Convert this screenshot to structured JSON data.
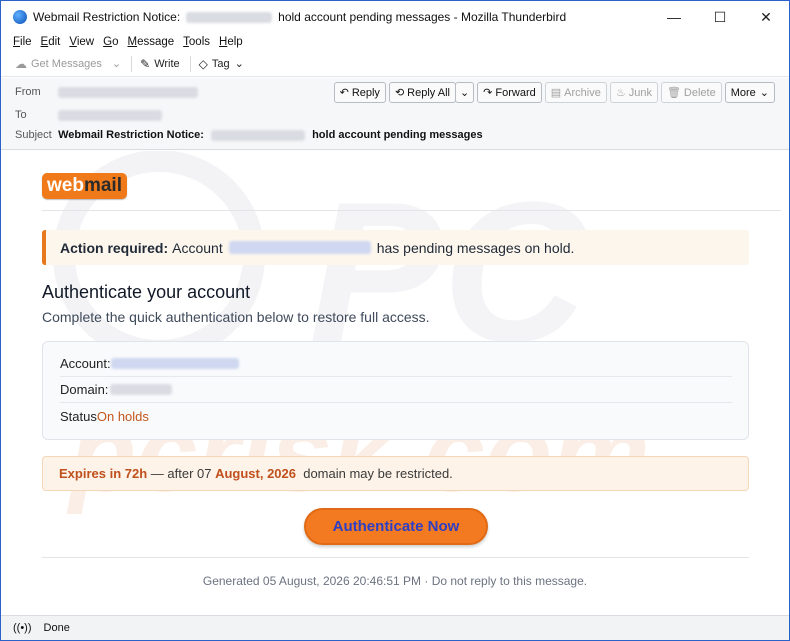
{
  "window": {
    "title_prefix": "Webmail Restriction Notice:",
    "title_suffix": "hold account pending messages - Mozilla Thunderbird",
    "controls": {
      "minimize": "—",
      "maximize": "☐",
      "close": "✕"
    }
  },
  "menubar": [
    {
      "key": "F",
      "rest": "ile"
    },
    {
      "key": "E",
      "rest": "dit"
    },
    {
      "key": "V",
      "rest": "iew"
    },
    {
      "key": "G",
      "rest": "o"
    },
    {
      "key": "M",
      "rest": "essage"
    },
    {
      "key": "T",
      "rest": "ools"
    },
    {
      "key": "H",
      "rest": "elp"
    }
  ],
  "toolbar": {
    "get_messages": "Get Messages",
    "write": "Write",
    "tag": "Tag"
  },
  "header": {
    "from_label": "From",
    "to_label": "To",
    "subject_label": "Subject",
    "subject_prefix": "Webmail Restriction Notice:",
    "subject_suffix": "hold account pending messages",
    "actions": {
      "reply": "Reply",
      "reply_all": "Reply All",
      "forward": "Forward",
      "archive": "Archive",
      "junk": "Junk",
      "delete": "Delete",
      "more": "More"
    }
  },
  "email": {
    "logo_web": "web",
    "logo_mail": "mail",
    "alert_strong": "Action required:",
    "alert_account": "Account",
    "alert_rest": "has pending messages on hold.",
    "heading": "Authenticate your account",
    "subheading": "Complete the quick authentication below to restore full access.",
    "account_label": "Account:",
    "domain_label": "Domain:",
    "status_label": "Status",
    "status_value": "On holds",
    "expires_em": "Expires in 72h",
    "expires_mid": " — after 07 ",
    "expires_date": "August, 2026",
    "expires_rest": "  domain may be restricted.",
    "cta": "Authenticate Now",
    "footer": "Generated 05 August, 2026 20:46:51 PM · Do not reply to this message."
  },
  "watermark_text": "pcrisk.com",
  "statusbar": {
    "text": "Done"
  },
  "colors": {
    "accent": "#f47a21",
    "cta_text": "#2d3fc4",
    "status": "#c2561a",
    "window_border": "#2a62c9"
  }
}
